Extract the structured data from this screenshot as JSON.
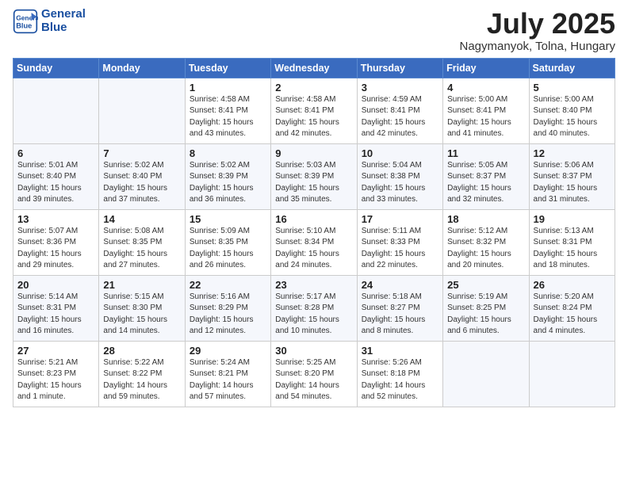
{
  "header": {
    "logo_line1": "General",
    "logo_line2": "Blue",
    "month": "July 2025",
    "location": "Nagymanyok, Tolna, Hungary"
  },
  "weekdays": [
    "Sunday",
    "Monday",
    "Tuesday",
    "Wednesday",
    "Thursday",
    "Friday",
    "Saturday"
  ],
  "weeks": [
    [
      {
        "day": "",
        "info": ""
      },
      {
        "day": "",
        "info": ""
      },
      {
        "day": "1",
        "info": "Sunrise: 4:58 AM\nSunset: 8:41 PM\nDaylight: 15 hours\nand 43 minutes."
      },
      {
        "day": "2",
        "info": "Sunrise: 4:58 AM\nSunset: 8:41 PM\nDaylight: 15 hours\nand 42 minutes."
      },
      {
        "day": "3",
        "info": "Sunrise: 4:59 AM\nSunset: 8:41 PM\nDaylight: 15 hours\nand 42 minutes."
      },
      {
        "day": "4",
        "info": "Sunrise: 5:00 AM\nSunset: 8:41 PM\nDaylight: 15 hours\nand 41 minutes."
      },
      {
        "day": "5",
        "info": "Sunrise: 5:00 AM\nSunset: 8:40 PM\nDaylight: 15 hours\nand 40 minutes."
      }
    ],
    [
      {
        "day": "6",
        "info": "Sunrise: 5:01 AM\nSunset: 8:40 PM\nDaylight: 15 hours\nand 39 minutes."
      },
      {
        "day": "7",
        "info": "Sunrise: 5:02 AM\nSunset: 8:40 PM\nDaylight: 15 hours\nand 37 minutes."
      },
      {
        "day": "8",
        "info": "Sunrise: 5:02 AM\nSunset: 8:39 PM\nDaylight: 15 hours\nand 36 minutes."
      },
      {
        "day": "9",
        "info": "Sunrise: 5:03 AM\nSunset: 8:39 PM\nDaylight: 15 hours\nand 35 minutes."
      },
      {
        "day": "10",
        "info": "Sunrise: 5:04 AM\nSunset: 8:38 PM\nDaylight: 15 hours\nand 33 minutes."
      },
      {
        "day": "11",
        "info": "Sunrise: 5:05 AM\nSunset: 8:37 PM\nDaylight: 15 hours\nand 32 minutes."
      },
      {
        "day": "12",
        "info": "Sunrise: 5:06 AM\nSunset: 8:37 PM\nDaylight: 15 hours\nand 31 minutes."
      }
    ],
    [
      {
        "day": "13",
        "info": "Sunrise: 5:07 AM\nSunset: 8:36 PM\nDaylight: 15 hours\nand 29 minutes."
      },
      {
        "day": "14",
        "info": "Sunrise: 5:08 AM\nSunset: 8:35 PM\nDaylight: 15 hours\nand 27 minutes."
      },
      {
        "day": "15",
        "info": "Sunrise: 5:09 AM\nSunset: 8:35 PM\nDaylight: 15 hours\nand 26 minutes."
      },
      {
        "day": "16",
        "info": "Sunrise: 5:10 AM\nSunset: 8:34 PM\nDaylight: 15 hours\nand 24 minutes."
      },
      {
        "day": "17",
        "info": "Sunrise: 5:11 AM\nSunset: 8:33 PM\nDaylight: 15 hours\nand 22 minutes."
      },
      {
        "day": "18",
        "info": "Sunrise: 5:12 AM\nSunset: 8:32 PM\nDaylight: 15 hours\nand 20 minutes."
      },
      {
        "day": "19",
        "info": "Sunrise: 5:13 AM\nSunset: 8:31 PM\nDaylight: 15 hours\nand 18 minutes."
      }
    ],
    [
      {
        "day": "20",
        "info": "Sunrise: 5:14 AM\nSunset: 8:31 PM\nDaylight: 15 hours\nand 16 minutes."
      },
      {
        "day": "21",
        "info": "Sunrise: 5:15 AM\nSunset: 8:30 PM\nDaylight: 15 hours\nand 14 minutes."
      },
      {
        "day": "22",
        "info": "Sunrise: 5:16 AM\nSunset: 8:29 PM\nDaylight: 15 hours\nand 12 minutes."
      },
      {
        "day": "23",
        "info": "Sunrise: 5:17 AM\nSunset: 8:28 PM\nDaylight: 15 hours\nand 10 minutes."
      },
      {
        "day": "24",
        "info": "Sunrise: 5:18 AM\nSunset: 8:27 PM\nDaylight: 15 hours\nand 8 minutes."
      },
      {
        "day": "25",
        "info": "Sunrise: 5:19 AM\nSunset: 8:25 PM\nDaylight: 15 hours\nand 6 minutes."
      },
      {
        "day": "26",
        "info": "Sunrise: 5:20 AM\nSunset: 8:24 PM\nDaylight: 15 hours\nand 4 minutes."
      }
    ],
    [
      {
        "day": "27",
        "info": "Sunrise: 5:21 AM\nSunset: 8:23 PM\nDaylight: 15 hours\nand 1 minute."
      },
      {
        "day": "28",
        "info": "Sunrise: 5:22 AM\nSunset: 8:22 PM\nDaylight: 14 hours\nand 59 minutes."
      },
      {
        "day": "29",
        "info": "Sunrise: 5:24 AM\nSunset: 8:21 PM\nDaylight: 14 hours\nand 57 minutes."
      },
      {
        "day": "30",
        "info": "Sunrise: 5:25 AM\nSunset: 8:20 PM\nDaylight: 14 hours\nand 54 minutes."
      },
      {
        "day": "31",
        "info": "Sunrise: 5:26 AM\nSunset: 8:18 PM\nDaylight: 14 hours\nand 52 minutes."
      },
      {
        "day": "",
        "info": ""
      },
      {
        "day": "",
        "info": ""
      }
    ]
  ]
}
